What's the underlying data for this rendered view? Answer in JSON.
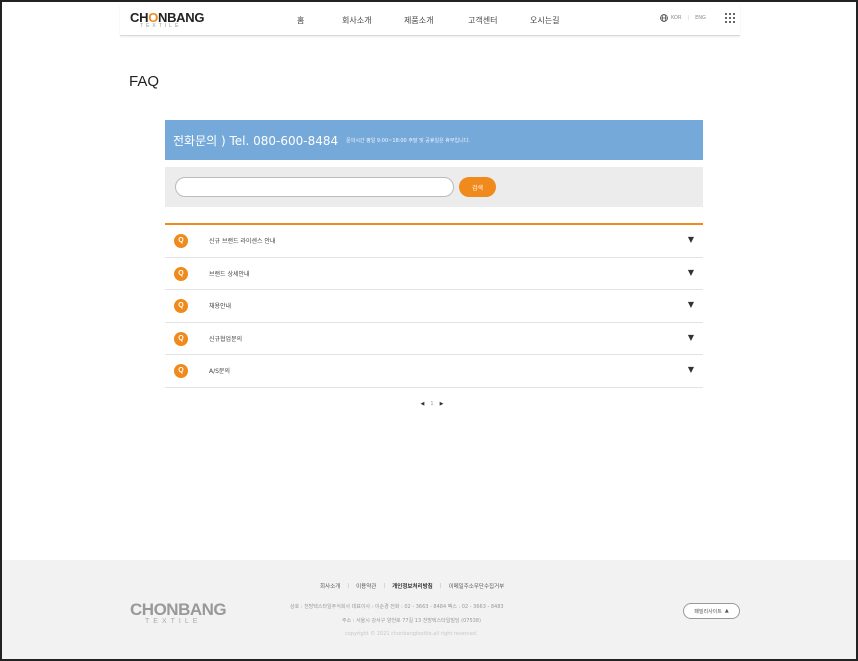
{
  "header": {
    "logo_main_a": "CH",
    "logo_main_o": "O",
    "logo_main_b": "NBANG",
    "logo_sub": "TEXTILE",
    "nav": [
      "홈",
      "회사소개",
      "제품소개",
      "고객센터",
      "오시는길"
    ],
    "lang_kr": "KOR",
    "lang_en": "ENG"
  },
  "page": {
    "title": "FAQ"
  },
  "phone": {
    "main": "전화문의 ) Tel. 080-600-8484",
    "sub": "문의시간 평일 9:00~18:00 주말 및 공휴일은 휴무입니다."
  },
  "search": {
    "value": "",
    "placeholder": "",
    "button": "검색"
  },
  "faq": {
    "badge": "Q",
    "arrow": "▼",
    "items": [
      "신규 브랜드 라이센스 안내",
      "브랜드 상세안내",
      "채용안내",
      "신규협업문의",
      "A/S문의"
    ]
  },
  "pagination": {
    "prev": "◀",
    "current": "1",
    "next": "▶"
  },
  "footer": {
    "logo_a": "CH",
    "logo_o": "O",
    "logo_b": "NBANG",
    "logo_sub": "TEXTILE",
    "links": [
      "회사소개",
      "이용약관",
      "개인정보처리방침",
      "이메일주소무단수집거부"
    ],
    "info": "상호 : 천방텍스타일주식회사   대표이사 : 이순경   전화 : 02 - 3663 - 8484   팩스 : 02 - 3663 - 8483",
    "address": "주소 : 서울시 강서구 양천로 77길 13 천방텍스타일빌딩 (07538)",
    "copyright": "copyright © 2021 chonbangtextile.all right reserved.",
    "family_site": "패밀리사이트",
    "family_arrow": "▲"
  },
  "colors": {
    "accent": "#f08a1c",
    "banner": "#74a9d9"
  }
}
